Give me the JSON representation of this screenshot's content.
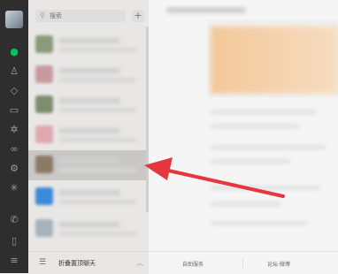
{
  "search": {
    "placeholder": "搜索"
  },
  "fold": {
    "label": "折叠置顶聊天"
  },
  "bottom": {
    "left": "自助服务",
    "right": "论坛·微博"
  },
  "colors": {
    "rail": "#2e2e2e",
    "accent": "#07c160",
    "arrow": "#e5373d"
  },
  "rail_icons": [
    "avatar",
    "chat-icon",
    "contacts-icon",
    "cube-icon",
    "folder-icon",
    "settings-icon",
    "link-icon",
    "gear-icon",
    "sparkle-icon",
    "phone-icon",
    "mobile-icon",
    "menu-icon"
  ],
  "rows": [
    {
      "avatar_color": "#8a9a7a"
    },
    {
      "avatar_color": "#c89aa0"
    },
    {
      "avatar_color": "#7d8d6e"
    },
    {
      "avatar_color": "#e0a7b0"
    },
    {
      "avatar_color": "#8c7a65"
    },
    {
      "avatar_color": "#3d8bd8"
    },
    {
      "avatar_color": "#a8b2bb"
    }
  ]
}
